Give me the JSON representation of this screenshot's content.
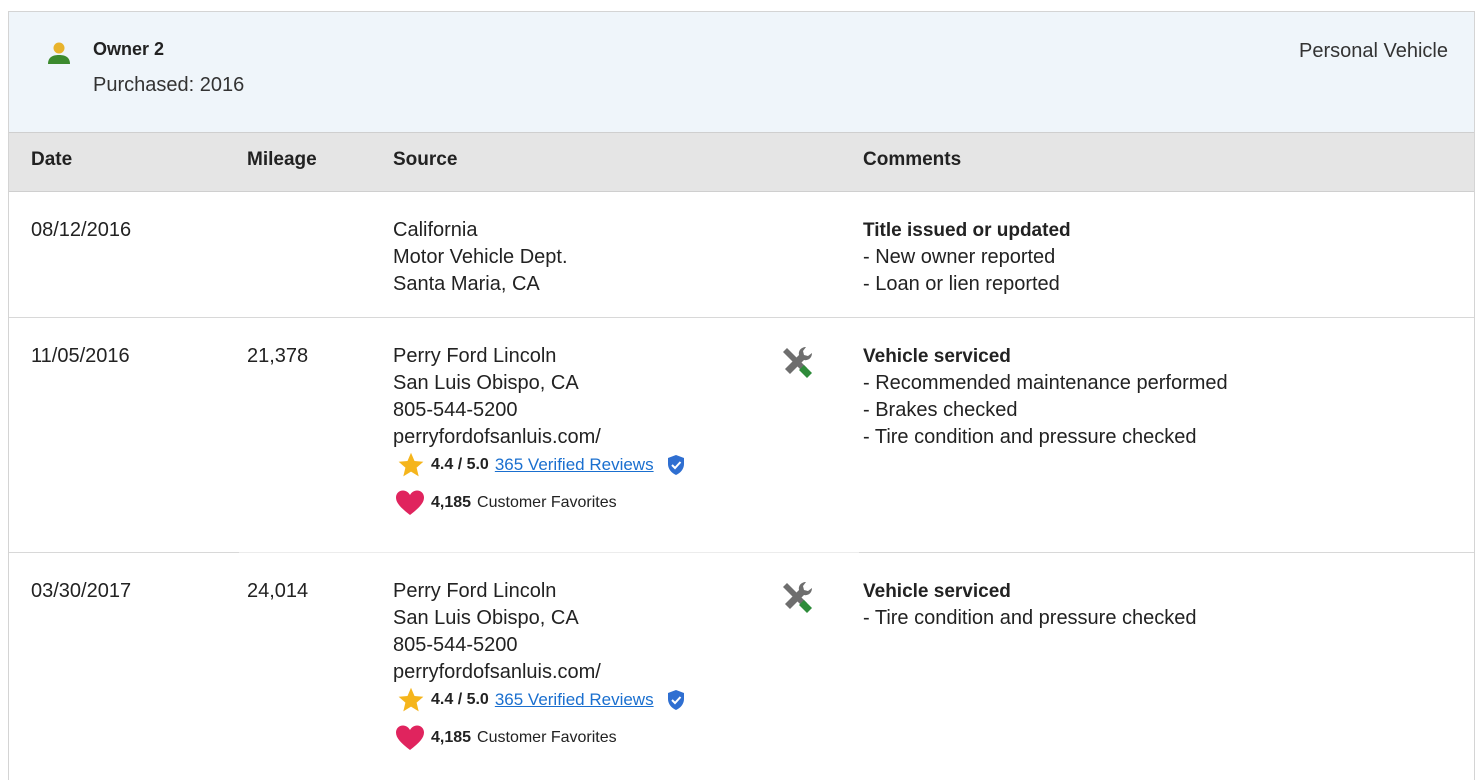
{
  "owner": {
    "name": "Owner 2",
    "purchased": "Purchased: 2016",
    "vehicle_type": "Personal Vehicle",
    "icon": "person-icon",
    "icon_color": "#3c8a2e"
  },
  "table": {
    "headers": {
      "date": "Date",
      "mileage": "Mileage",
      "source": "Source",
      "comments": "Comments"
    }
  },
  "rows": [
    {
      "date": "08/12/2016",
      "mileage": "",
      "source": [
        "California",
        "Motor Vehicle Dept.",
        "Santa Maria, CA"
      ],
      "comment_title": "Title issued or updated",
      "comment_items": [
        "- New owner reported",
        "- Loan or lien reported"
      ]
    },
    {
      "date": "11/05/2016",
      "mileage": "21,378",
      "source": [
        "Perry Ford Lincoln",
        "San Luis Obispo, CA",
        "805-544-5200",
        "perryfordofsanluis.com/"
      ],
      "icon": "service-tools-icon",
      "rating": {
        "score": "4.4 / 5.0",
        "reviews_link": "365 Verified Reviews"
      },
      "favorites": {
        "count": "4,185",
        "label": "Customer Favorites"
      },
      "comment_title": "Vehicle serviced",
      "comment_items": [
        "- Recommended maintenance performed",
        "- Brakes checked",
        "- Tire condition and pressure checked"
      ]
    },
    {
      "date": "03/30/2017",
      "mileage": "24,014",
      "source": [
        "Perry Ford Lincoln",
        "San Luis Obispo, CA",
        "805-544-5200",
        "perryfordofsanluis.com/"
      ],
      "icon": "service-tools-icon",
      "rating": {
        "score": "4.4 / 5.0",
        "reviews_link": "365 Verified Reviews"
      },
      "favorites": {
        "count": "4,185",
        "label": "Customer Favorites"
      },
      "comment_title": "Vehicle serviced",
      "comment_items": [
        "- Tire condition and pressure checked"
      ]
    }
  ],
  "colors": {
    "header_bg": "#eff5fa",
    "table_head_bg": "#e5e5e5",
    "link": "#1a6fcf",
    "star": "#f5b51c",
    "heart": "#e0245e",
    "verified": "#2f6fd1",
    "tool_green": "#2e8b3a",
    "tool_gray": "#6e6e6e"
  }
}
